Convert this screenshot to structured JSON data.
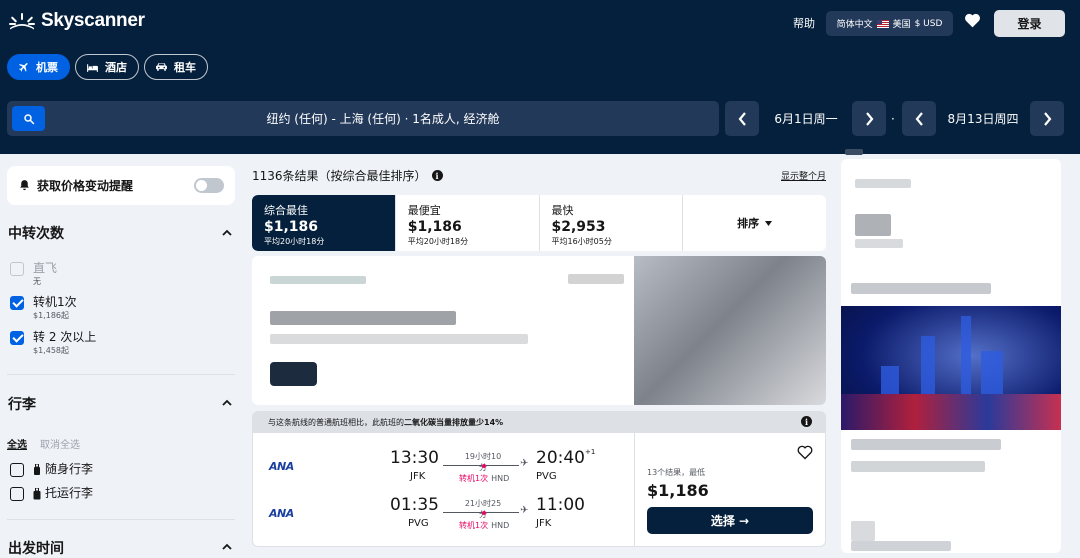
{
  "header": {
    "logo_text": "Skyscanner",
    "help": "帮助",
    "locale": {
      "language": "简体中文",
      "country": "美国",
      "currency": "$ USD"
    },
    "login": "登录"
  },
  "nav_tabs": [
    {
      "label": "机票",
      "icon": "plane-icon",
      "active": true
    },
    {
      "label": "酒店",
      "icon": "bed-icon",
      "active": false
    },
    {
      "label": "租车",
      "icon": "car-icon",
      "active": false
    }
  ],
  "search": {
    "summary": "纽约 (任何) - 上海 (任何) · 1名成人, 经济舱",
    "depart_date": "6月1日周一",
    "return_date": "8月13日周四",
    "separator": "·"
  },
  "sidebar": {
    "price_alert": "获取价格变动提醒",
    "stops": {
      "title": "中转次数",
      "options": [
        {
          "label": "直飞",
          "sub": "无",
          "checked": false,
          "disabled": true
        },
        {
          "label": "转机1次",
          "sub": "$1,186起",
          "checked": true,
          "disabled": false
        },
        {
          "label": "转 2 次以上",
          "sub": "$1,458起",
          "checked": true,
          "disabled": false
        }
      ]
    },
    "baggage": {
      "title": "行李",
      "select_all": "全选",
      "clear_all": "取消全选",
      "options": [
        {
          "label": "随身行李",
          "checked": false
        },
        {
          "label": "托运行李",
          "checked": false
        }
      ]
    },
    "depart_time": {
      "title": "出发时间"
    }
  },
  "results": {
    "count_text": "1136条结果（按综合最佳排序）",
    "show_month": "显示整个月"
  },
  "sort_tabs": [
    {
      "title": "综合最佳",
      "price": "$1,186",
      "sub": "平均20小时18分",
      "active": true
    },
    {
      "title": "最便宜",
      "price": "$1,186",
      "sub": "平均20小时18分",
      "active": false
    },
    {
      "title": "最快",
      "price": "$2,953",
      "sub": "平均16小时05分",
      "active": false
    }
  ],
  "sort_button": "排序",
  "eco_banner": {
    "prefix": "与这条航线的普通航班相比，此航班的",
    "highlight": "二氧化碳当量排放量少14%"
  },
  "flight": {
    "legs": [
      {
        "airline": "ANA",
        "depart_time": "13:30",
        "depart_airport": "JFK",
        "duration": "19小时10分",
        "stops": "转机1次",
        "via": "HND",
        "arrive_time": "20:40",
        "day_offset": "+1",
        "arrive_airport": "PVG"
      },
      {
        "airline": "ANA",
        "depart_time": "01:35",
        "depart_airport": "PVG",
        "duration": "21小时25分",
        "stops": "转机1次",
        "via": "HND",
        "arrive_time": "11:00",
        "day_offset": "",
        "arrive_airport": "JFK"
      }
    ],
    "deals_text": "13个结果，最低",
    "price": "$1,186",
    "select_label": "选择 →"
  },
  "colors": {
    "header_bg": "#05203c",
    "accent_blue": "#0062e3",
    "stop_pink": "#e70866",
    "field_bg": "#23395a"
  }
}
